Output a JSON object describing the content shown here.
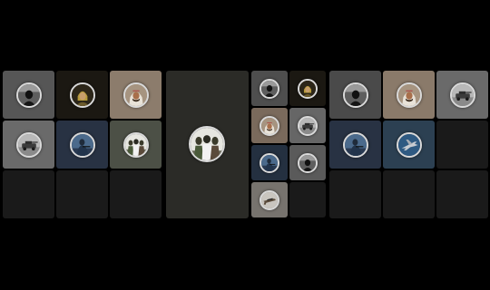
{
  "colors": {
    "page_background": "#000000",
    "empty_tile": "#1a1a1a",
    "large_tile": "#2b2b27",
    "avatar_ring": "#d9d9d9"
  },
  "panels": {
    "left": {
      "tiles": [
        {
          "photo": "dark-figure",
          "tile_color": "#565656"
        },
        {
          "photo": "man-in-headscarf",
          "tile_color": "#1b1812"
        },
        {
          "photo": "man-in-keffiyeh",
          "tile_color": "#8c7c6c"
        },
        {
          "photo": "armored-vehicle",
          "tile_color": "#6a6a6a"
        },
        {
          "photo": "soldier-blue",
          "tile_color": "#283243"
        },
        {
          "photo": "group-of-men",
          "tile_color": "#4c5046"
        }
      ]
    },
    "center": {
      "featured_photo": "group-of-men",
      "small_tiles": [
        {
          "photo": "dark-figure",
          "tile_color": "#4e4e4e"
        },
        {
          "photo": "man-in-headscarf",
          "tile_color": "#1b1812"
        },
        {
          "photo": "man-in-keffiyeh",
          "tile_color": "#7a6a5c"
        },
        {
          "photo": "armored-vehicle",
          "tile_color": "#666666"
        },
        {
          "photo": "soldier-blue",
          "tile_color": "#243040"
        },
        {
          "photo": "dark-figure",
          "tile_color": "#5a5a5a"
        },
        {
          "photo": "weapon",
          "tile_color": "#77736e"
        }
      ]
    },
    "right": {
      "tiles": [
        {
          "photo": "dark-figure",
          "tile_color": "#4a4a4a"
        },
        {
          "photo": "man-in-keffiyeh",
          "tile_color": "#8a7a6a"
        },
        {
          "photo": "armored-vehicle",
          "tile_color": "#6a6a6a"
        },
        {
          "photo": "soldier-blue",
          "tile_color": "#283243"
        },
        {
          "photo": "fighter-jet",
          "tile_color": "#2c4052"
        }
      ]
    }
  }
}
